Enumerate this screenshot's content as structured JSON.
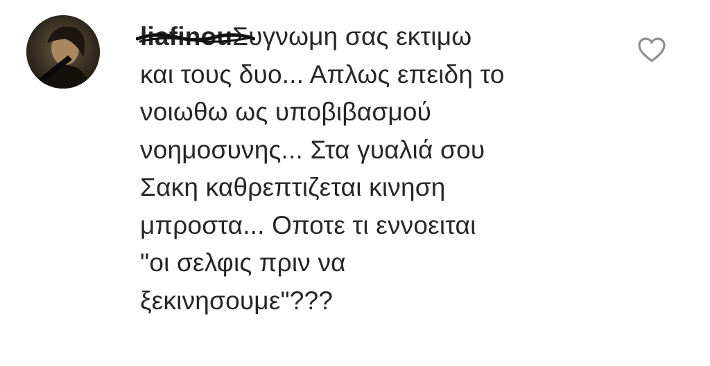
{
  "comment": {
    "username": "liafinou",
    "text_lines": [
      "Συγνωμη σας εκτιμω",
      "και τους δυο... Απλως επειδη το",
      "νοιωθω ως υποβιβασμού",
      "νοημοσυνης... Στα γυαλιά σου",
      "Σακη καθρεπτιζεται κινηση",
      "μπροστα... Οποτε τι εννοειται",
      "\"οι σελφις πριν να",
      "ξεκινησουμε\"???"
    ]
  },
  "icons": {
    "avatar": "user-avatar",
    "like": "heart-icon"
  },
  "colors": {
    "text": "#262626",
    "icon_stroke": "#8e8e8e",
    "background": "#ffffff"
  }
}
